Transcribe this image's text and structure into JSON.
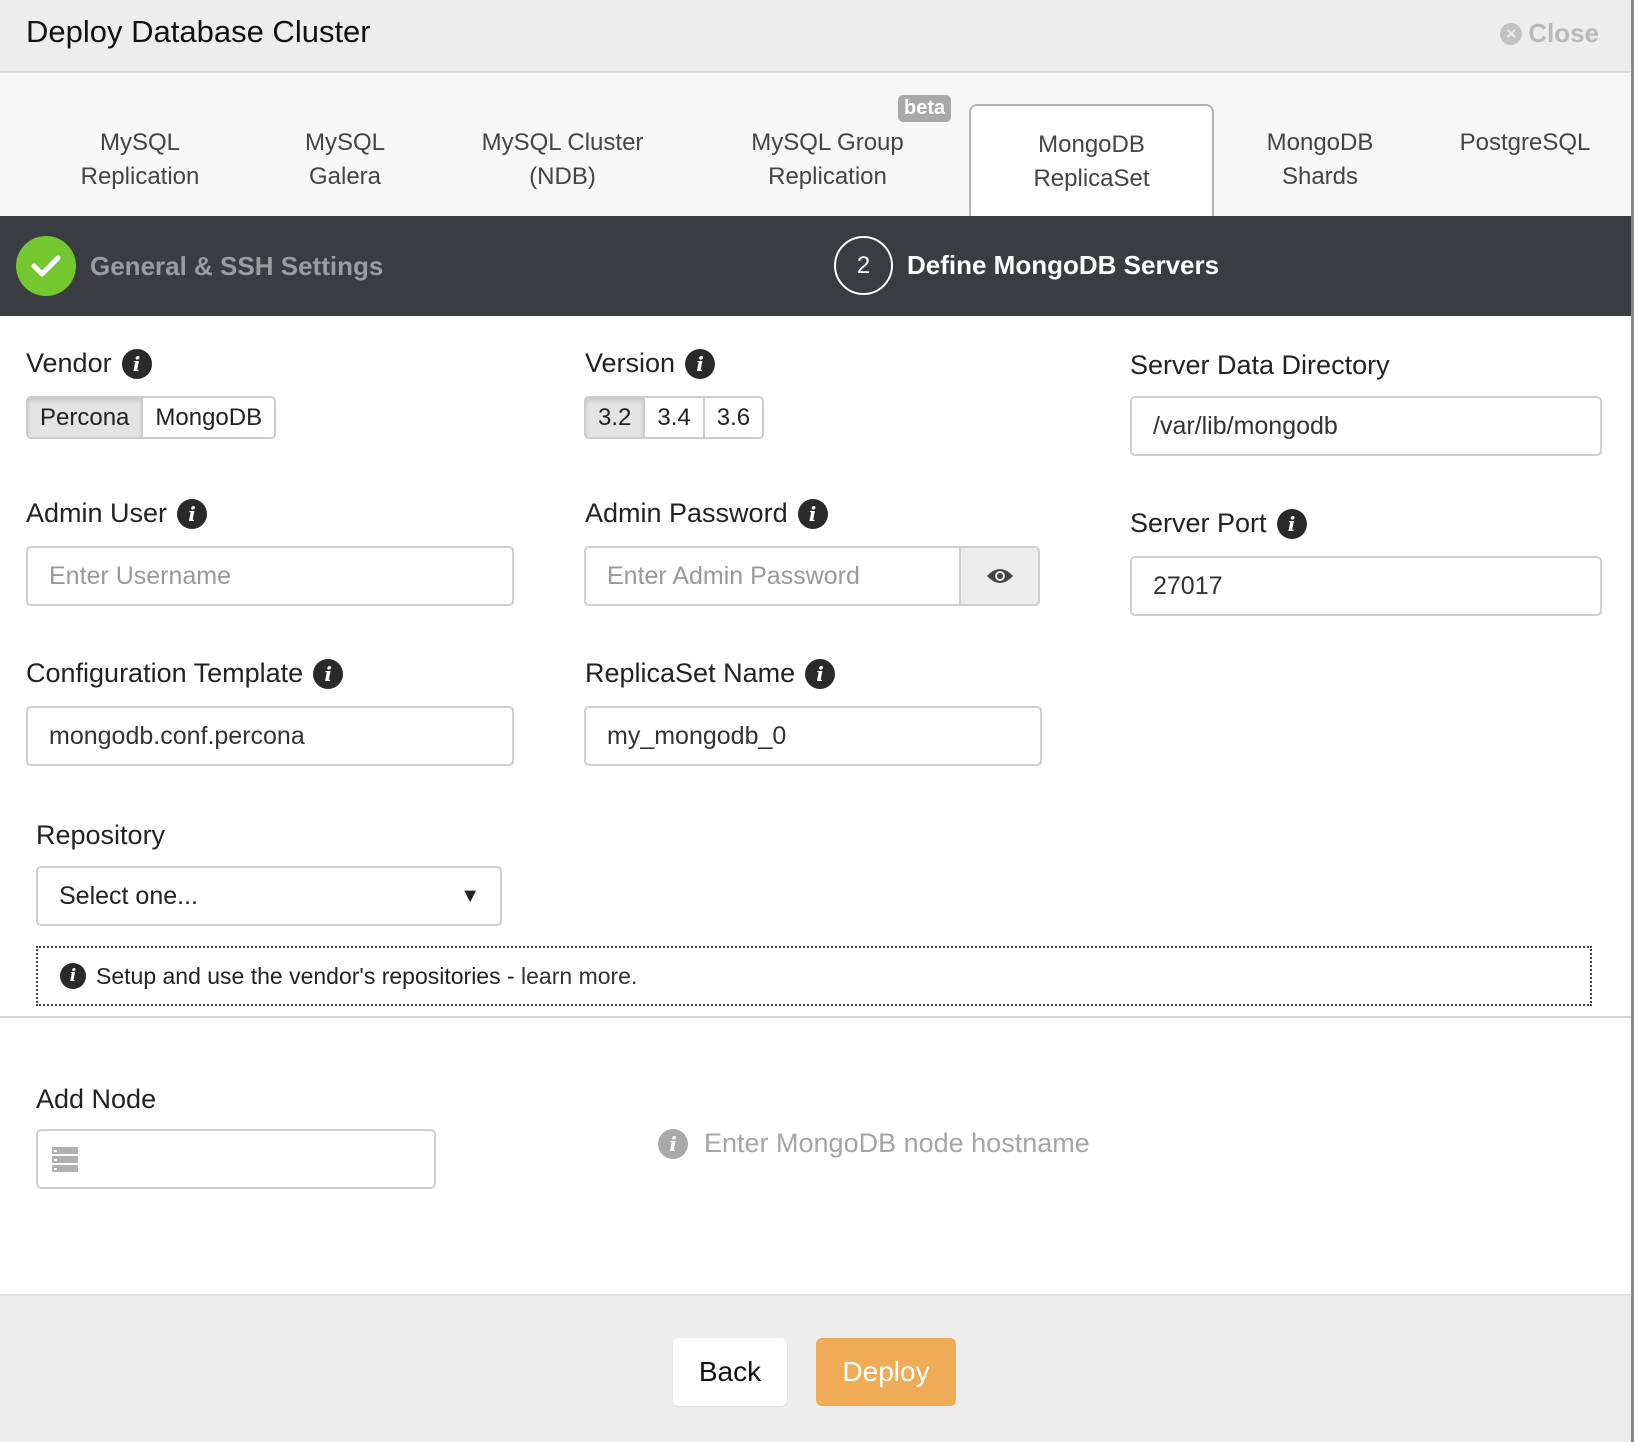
{
  "dialog": {
    "title": "Deploy Database Cluster",
    "close_label": "Close"
  },
  "tabs": [
    {
      "line1": "MySQL",
      "line2": "Replication"
    },
    {
      "line1": "MySQL",
      "line2": "Galera"
    },
    {
      "line1": "MySQL Cluster",
      "line2": "(NDB)"
    },
    {
      "line1": "MySQL Group",
      "line2": "Replication",
      "badge": "beta"
    },
    {
      "line1": "MongoDB",
      "line2": "ReplicaSet",
      "active": true
    },
    {
      "line1": "MongoDB",
      "line2": "Shards"
    },
    {
      "line1": "PostgreSQL",
      "line2": ""
    }
  ],
  "steps": [
    {
      "label": "General & SSH Settings",
      "status": "done"
    },
    {
      "number": "2",
      "label": "Define MongoDB Servers",
      "status": "current"
    }
  ],
  "form": {
    "vendor": {
      "label": "Vendor",
      "options": [
        "Percona",
        "MongoDB"
      ],
      "selected": "Percona"
    },
    "version": {
      "label": "Version",
      "options": [
        "3.2",
        "3.4",
        "3.6"
      ],
      "selected": "3.2"
    },
    "data_dir": {
      "label": "Server Data Directory",
      "value": "/var/lib/mongodb"
    },
    "admin_user": {
      "label": "Admin User",
      "placeholder": "Enter Username",
      "value": ""
    },
    "admin_password": {
      "label": "Admin Password",
      "placeholder": "Enter Admin Password",
      "value": ""
    },
    "server_port": {
      "label": "Server Port",
      "value": "27017"
    },
    "config_template": {
      "label": "Configuration Template",
      "value": "mongodb.conf.percona"
    },
    "replicaset_name": {
      "label": "ReplicaSet Name",
      "value": "my_mongodb_0"
    },
    "repository": {
      "label": "Repository",
      "selected": "Select one..."
    },
    "repo_notice": {
      "text": "Setup and use the vendor's repositories - ",
      "link": "learn more."
    },
    "add_node": {
      "label": "Add Node",
      "value": "",
      "hint": "Enter MongoDB node hostname"
    }
  },
  "footer": {
    "back_label": "Back",
    "deploy_label": "Deploy"
  },
  "colors": {
    "accent_deploy": "#efab55",
    "step_done": "#74c72e",
    "stepbar_bg": "#393d41"
  }
}
